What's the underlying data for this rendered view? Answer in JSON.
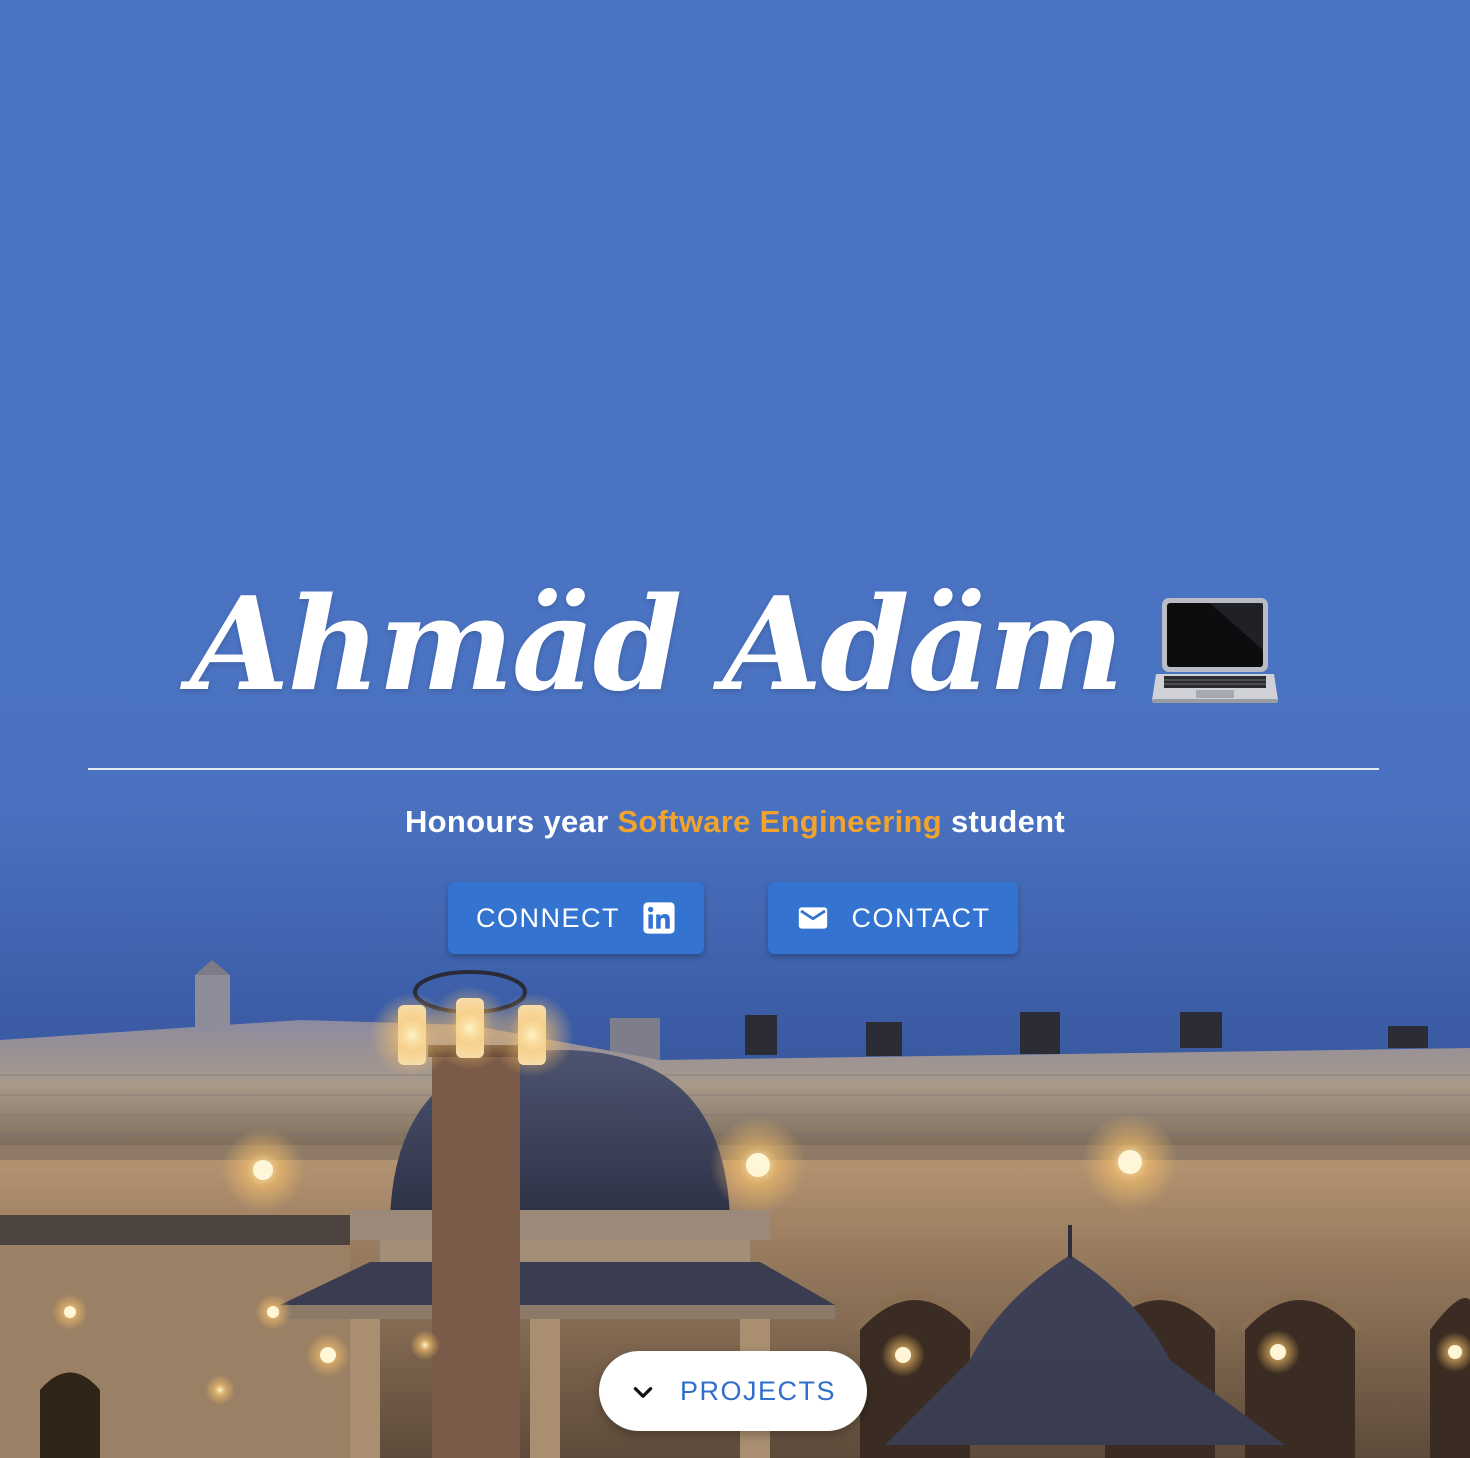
{
  "hero": {
    "name": "Ahmäd Adäm",
    "emoji_icon": "laptop-icon",
    "tagline": {
      "before": "Honours year ",
      "highlight": "Software Engineering",
      "after": " student"
    }
  },
  "buttons": {
    "connect": {
      "label": "CONNECT",
      "icon": "linkedin-icon"
    },
    "contact": {
      "label": "CONTACT",
      "icon": "mail-icon"
    },
    "projects": {
      "label": "PROJECTS",
      "icon": "chevron-down-icon"
    }
  },
  "colors": {
    "sky": "#4a73c4",
    "accent": "#f0a32e",
    "button": "#3474d0",
    "projects_text": "#2f6fcb"
  }
}
